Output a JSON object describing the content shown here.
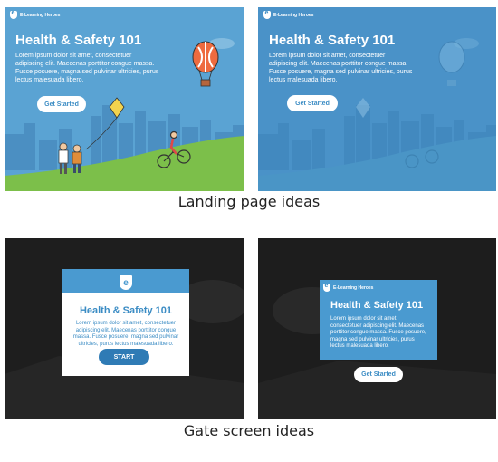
{
  "landing": {
    "light": {
      "brand": "E-Learning Heroes",
      "title": "Health & Safety 101",
      "body": "Lorem ipsum dolor sit amet, consectetuer adipiscing elit. Maecenas porttitor congue massa. Fusce posuere, magna sed pulvinar ultricies, purus lectus malesuada libero.",
      "button": "Get Started"
    },
    "dark": {
      "brand": "E-Learning Heroes",
      "title": "Health & Safety 101",
      "body": "Lorem ipsum dolor sit amet, consectetuer adipiscing elit. Maecenas porttitor congue massa. Fusce posuere, magna sed pulvinar ultricies, purus lectus malesuada libero.",
      "button": "Get Started"
    },
    "caption": "Landing page ideas"
  },
  "gate": {
    "card": {
      "title": "Health & Safety 101",
      "body": "Lorem ipsum dolor sit amet, consectetuer adipiscing elit. Maecenas porttitor congue massa. Fusce posuere, magna sed pulvinar ultricies, purus lectus malesuada libero.",
      "button": "START"
    },
    "blue": {
      "brand": "E-Learning Heroes",
      "title": "Health & Safety 101",
      "body": "Lorem ipsum dolor sit amet, consectetuer adipiscing elit. Maecenas porttitor congue massa. Fusce posuere, magna sed pulvinar ultricies, purus lectus malesuada libero.",
      "button": "Get Started"
    },
    "caption": "Gate screen ideas"
  },
  "colors": {
    "sky_light": "#5aa3d3",
    "sky_dark": "#4a92c8",
    "grass": "#7cbf4a",
    "city": "#3e80b3",
    "accent": "#3b8cc4",
    "balloon": "#ee6b3f"
  },
  "icons": [
    "shield-logo-icon",
    "hot-air-balloon-icon",
    "kite-icon",
    "bicycle-rider-icon",
    "city-skyline-icon"
  ]
}
